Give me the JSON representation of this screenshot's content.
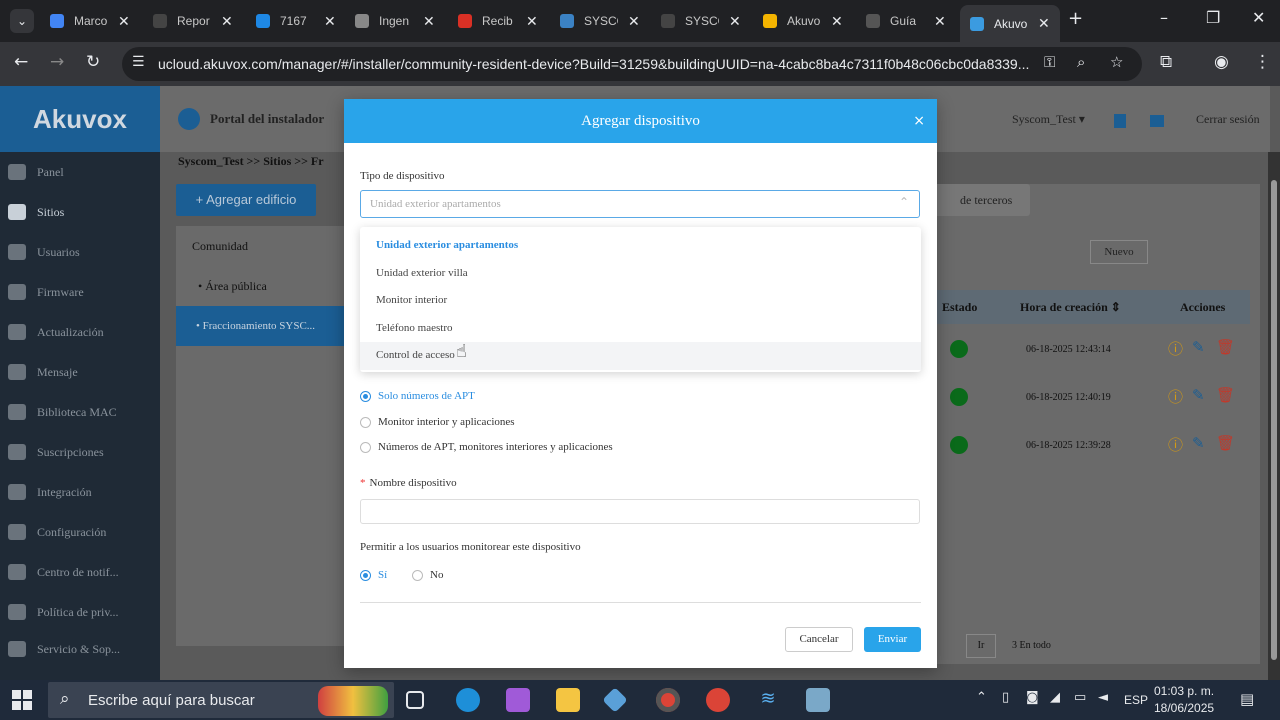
{
  "browser": {
    "tabs": [
      {
        "title": "Marco",
        "color": "#4285f4"
      },
      {
        "title": "Repor",
        "color": "#444"
      },
      {
        "title": "7167",
        "color": "#1e88e5"
      },
      {
        "title": "Ingen",
        "color": "#888"
      },
      {
        "title": "Recib",
        "color": "#d93025"
      },
      {
        "title": "SYSCO",
        "color": "#3b82c4"
      },
      {
        "title": "SYSCO",
        "color": "#444"
      },
      {
        "title": "Akuvo",
        "color": "#f4b400"
      },
      {
        "title": "Guía",
        "color": "#555"
      },
      {
        "title": "Akuvo",
        "color": "#3b9be0"
      }
    ],
    "url": "ucloud.akuvox.com/manager/#/installer/community-resident-device?Build=31259&buildingUUID=na-4cabc8ba4c7311f0b48c06cbc0da8339..."
  },
  "app": {
    "logo": "Akuvox",
    "portal_title": "Portal del instalador",
    "user": "Syscom_Test ▾",
    "logout": "Cerrar sesión",
    "sidebar": [
      {
        "label": "Panel"
      },
      {
        "label": "Sitios"
      },
      {
        "label": "Usuarios"
      },
      {
        "label": "Firmware"
      },
      {
        "label": "Actualización"
      },
      {
        "label": "Mensaje"
      },
      {
        "label": "Biblioteca MAC"
      },
      {
        "label": "Suscripciones"
      },
      {
        "label": "Integración"
      },
      {
        "label": "Configuración"
      },
      {
        "label": "Centro de notif..."
      },
      {
        "label": "Política de priv..."
      },
      {
        "label": "Servicio & Sop..."
      }
    ],
    "breadcrumb": "Syscom_Test >> Sitios >> Fr",
    "add_building": "+ Agregar edificio",
    "tree": [
      "Comunidad",
      "• Área pública",
      "• Fraccionamiento SYSC..."
    ],
    "third_party": "de terceros",
    "new_button": "Nuevo",
    "table_headers": {
      "status": "Estado",
      "created": "Hora de creación ⇕",
      "actions": "Acciones"
    },
    "rows": [
      {
        "time": "06-18-2025 12:43:14"
      },
      {
        "time": "06-18-2025 12:40:19"
      },
      {
        "time": "06-18-2025 12:39:28"
      }
    ],
    "pager_go": "Ir",
    "pager_total": "3 En todo"
  },
  "modal": {
    "title": "Agregar dispositivo",
    "close": "×",
    "device_type_label": "Tipo de dispositivo",
    "device_type_value": "Unidad exterior apartamentos",
    "options": [
      "Unidad exterior apartamentos",
      "Unidad exterior villa",
      "Monitor interior",
      "Teléfono maestro",
      "Control de acceso"
    ],
    "radio_group": [
      "Solo números de APT",
      "Monitor interior y aplicaciones",
      "Números de APT, monitores interiores y aplicaciones"
    ],
    "name_label": "Nombre dispositivo",
    "name_value": "",
    "monitor_label": "Permitir a los usuarios monitorear este dispositivo",
    "monitor_yes": "Sí",
    "monitor_no": "No",
    "cancel": "Cancelar",
    "submit": "Enviar"
  },
  "taskbar": {
    "search_placeholder": "Escribe aquí para buscar",
    "language": "ESP",
    "time": "01:03 p. m.",
    "date": "18/06/2025"
  }
}
